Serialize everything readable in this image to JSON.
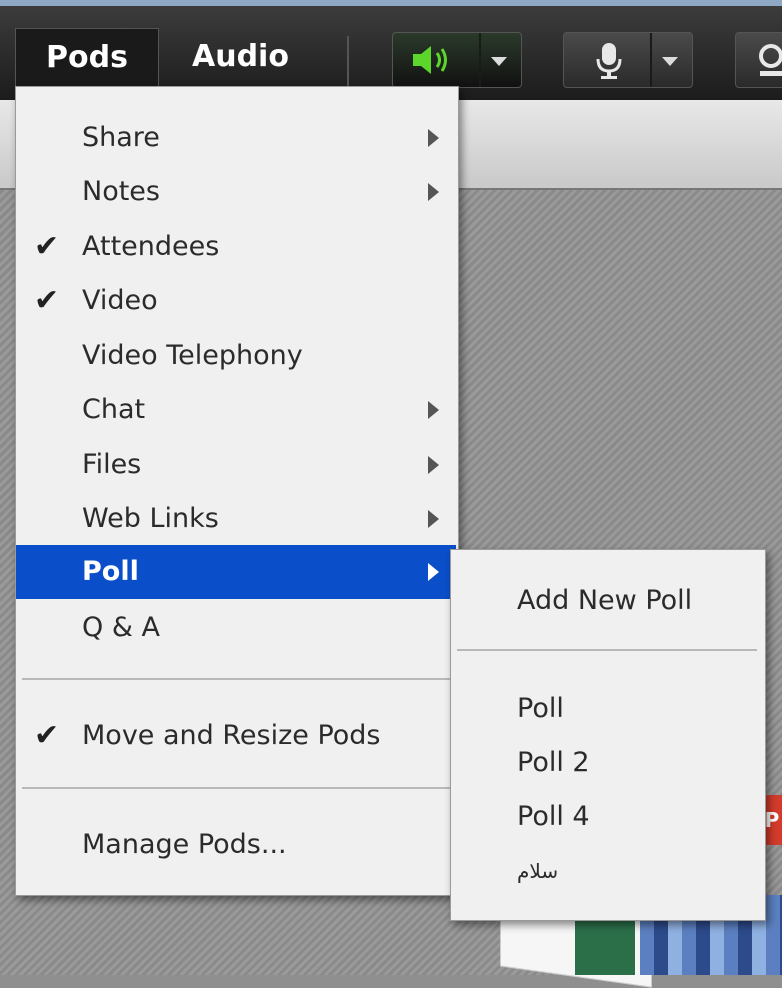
{
  "menubar": {
    "pods_label": "Pods",
    "audio_label": "Audio"
  },
  "icons": {
    "speaker": "speaker-icon",
    "microphone": "microphone-icon",
    "dropdown": "chevron-down-icon",
    "submenu": "chevron-right-icon",
    "check": "checkmark-icon"
  },
  "colors": {
    "highlight": "#0a4fc9",
    "speaker_on": "#5cd62a"
  },
  "pods_menu": {
    "items": [
      {
        "label": "Share",
        "checked": false,
        "submenu": true
      },
      {
        "label": "Notes",
        "checked": false,
        "submenu": true
      },
      {
        "label": "Attendees",
        "checked": true,
        "submenu": false
      },
      {
        "label": "Video",
        "checked": true,
        "submenu": false
      },
      {
        "label": "Video Telephony",
        "checked": false,
        "submenu": false
      },
      {
        "label": "Chat",
        "checked": false,
        "submenu": true
      },
      {
        "label": "Files",
        "checked": false,
        "submenu": true
      },
      {
        "label": "Web Links",
        "checked": false,
        "submenu": true
      },
      {
        "label": "Poll",
        "checked": false,
        "submenu": true,
        "highlighted": true
      },
      {
        "label": "Q & A",
        "checked": false,
        "submenu": false
      }
    ],
    "move_resize": {
      "label": "Move and Resize Pods",
      "checked": true
    },
    "manage": {
      "label": "Manage Pods..."
    }
  },
  "poll_submenu": {
    "add_new": "Add New Poll",
    "polls": [
      "Poll",
      "Poll 2",
      "Poll 4",
      "سلام"
    ]
  },
  "background": {
    "badge_text": "P"
  }
}
